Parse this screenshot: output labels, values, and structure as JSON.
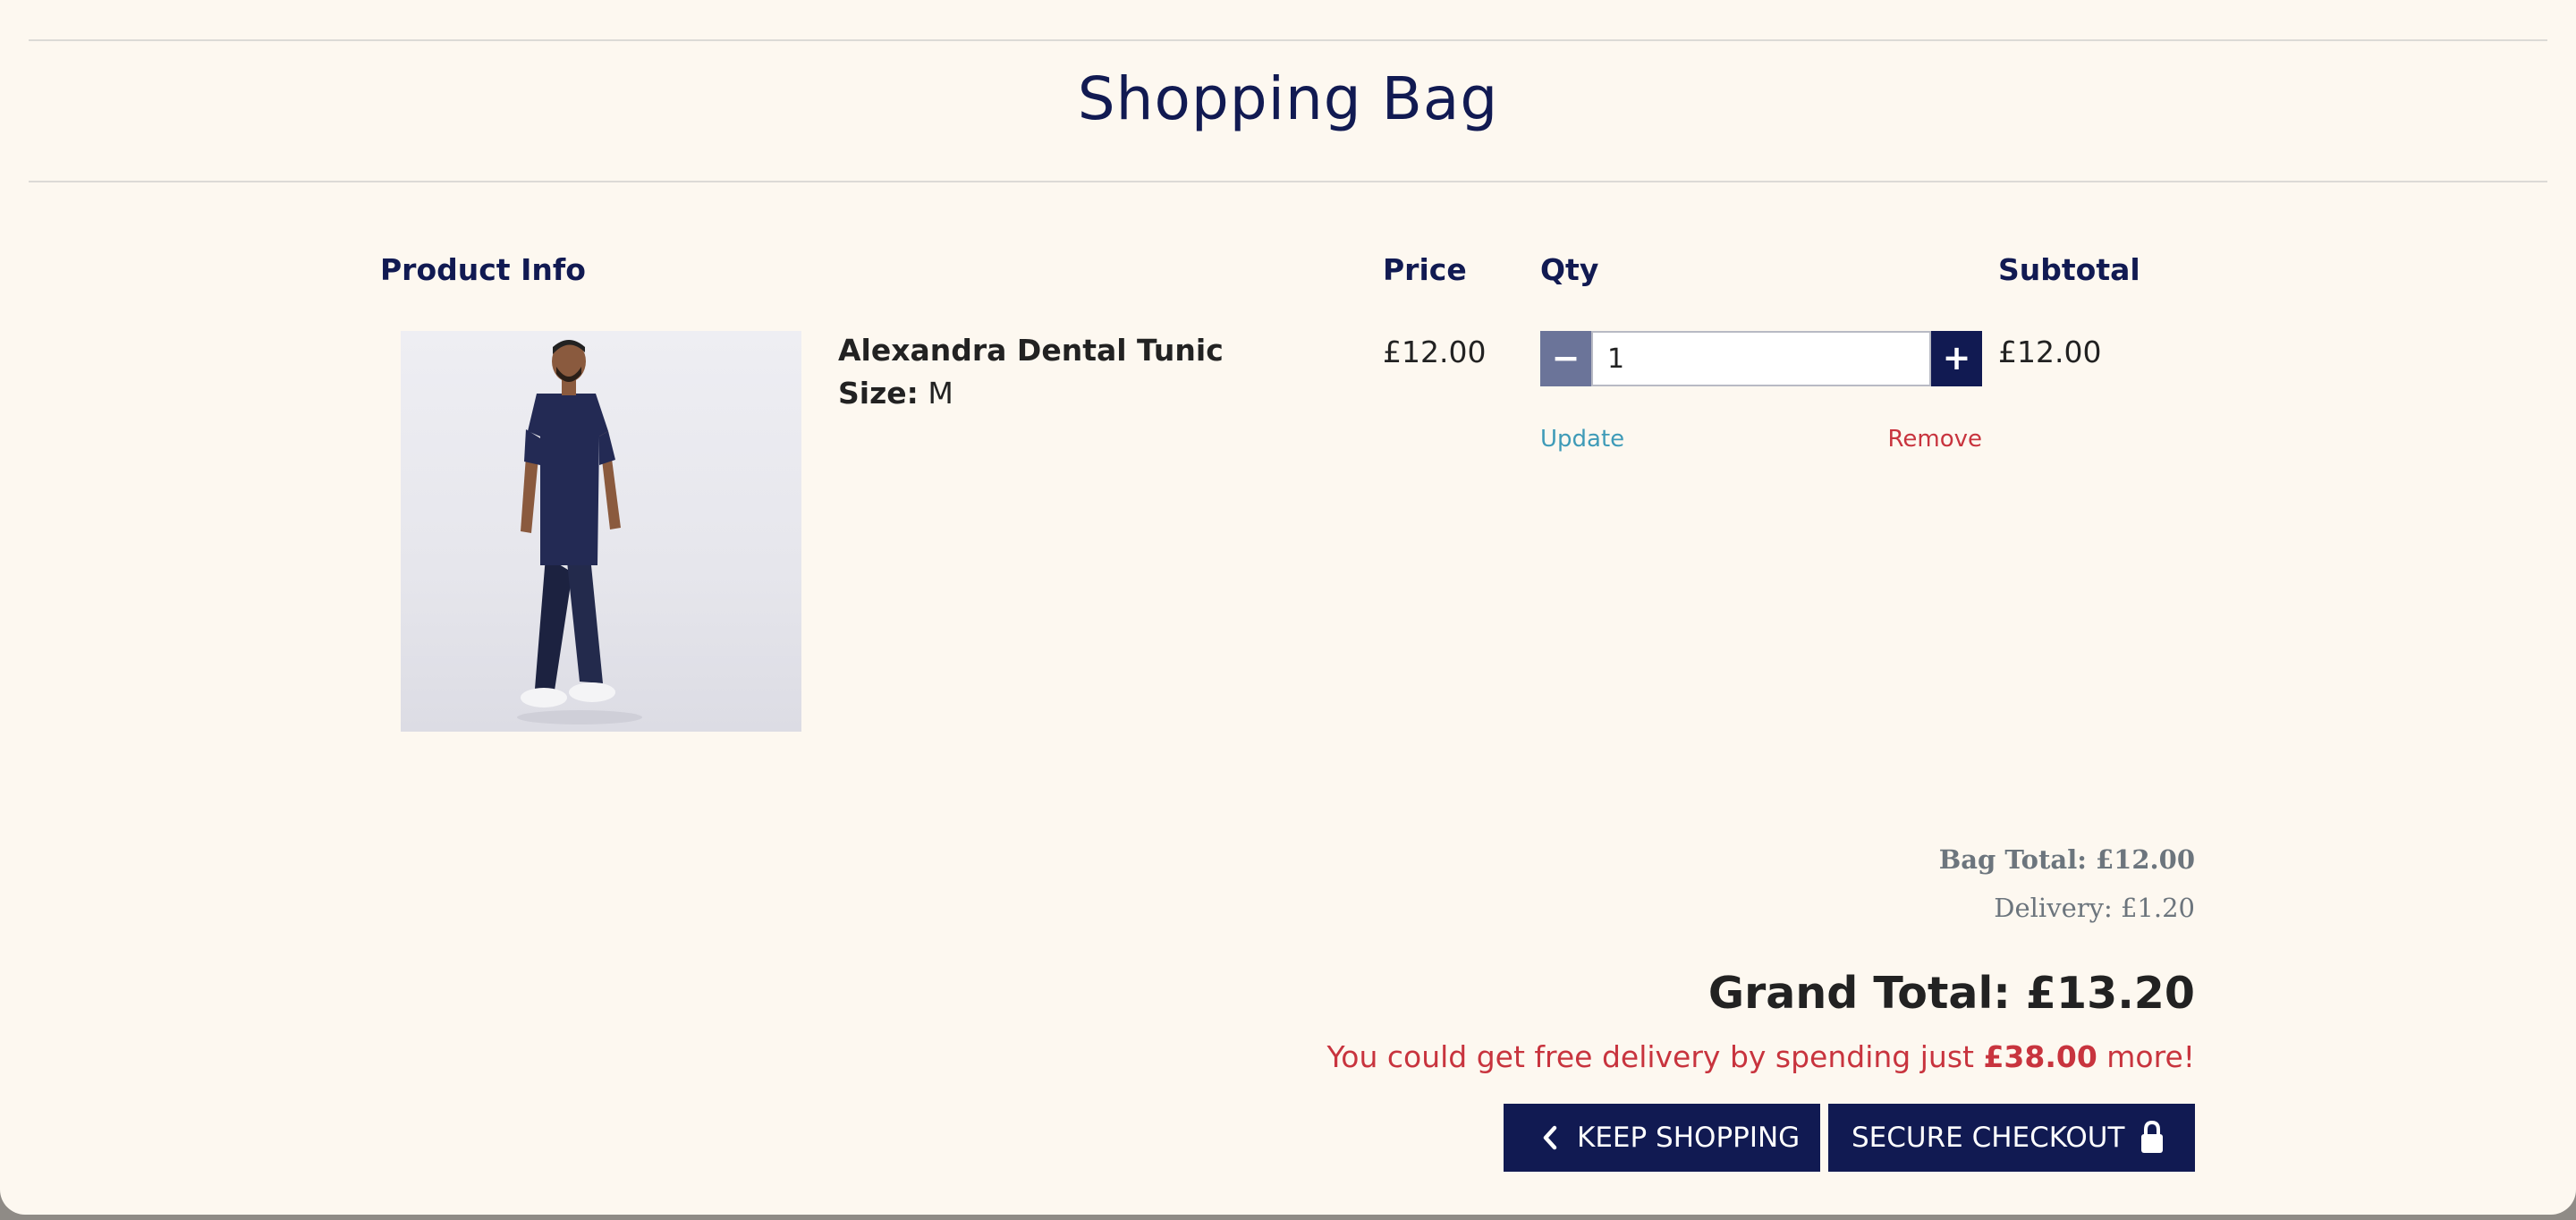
{
  "page": {
    "title": "Shopping Bag"
  },
  "table": {
    "headers": {
      "product_info": "Product Info",
      "price": "Price",
      "qty": "Qty",
      "subtotal": "Subtotal"
    }
  },
  "item": {
    "name": "Alexandra Dental Tunic",
    "size_label": "Size:",
    "size_value": "M",
    "price": "£12.00",
    "quantity": "1",
    "subtotal": "£12.00",
    "update_label": "Update",
    "remove_label": "Remove",
    "image_icon": "product-photo-person-in-navy-scrubs"
  },
  "summary": {
    "bag_total": "Bag Total: £12.00",
    "delivery": "Delivery: £1.20",
    "grand_total": "Grand Total: £13.20",
    "free_delivery_prefix": "You could get free delivery by spending just ",
    "free_delivery_amount": "£38.00",
    "free_delivery_suffix": " more!"
  },
  "actions": {
    "keep_shopping": "KEEP SHOPPING",
    "keep_shopping_icon": "chevron-left-icon",
    "secure_checkout": "SECURE CHECKOUT",
    "secure_checkout_icon": "lock-icon"
  },
  "colors": {
    "navy": "#111a52",
    "muted_navy": "#6b7499",
    "accent_red": "#c8343e",
    "link_teal": "#3f9bb8",
    "page_bg": "#fdf8f0"
  }
}
